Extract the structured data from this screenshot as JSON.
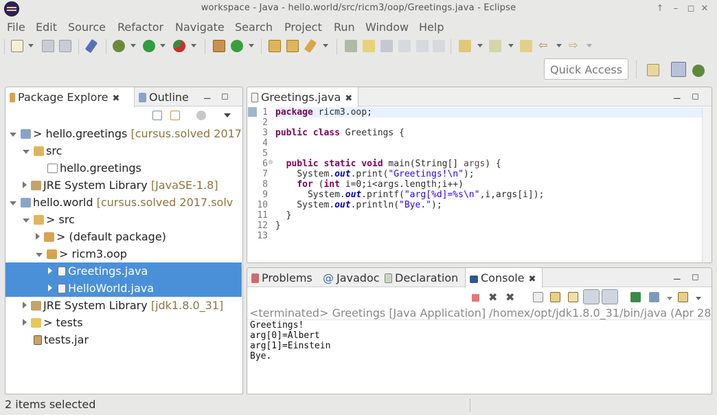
{
  "window": {
    "title": "workspace - Java - hello.world/src/ricm3/oop/Greetings.java - Eclipse"
  },
  "menu": [
    "File",
    "Edit",
    "Source",
    "Refactor",
    "Navigate",
    "Search",
    "Project",
    "Run",
    "Window",
    "Help"
  ],
  "quick_access": {
    "label": "Quick Access"
  },
  "left_pane": {
    "tabs": [
      {
        "label": "Package Explore"
      },
      {
        "label": "Outline"
      }
    ],
    "tree": [
      {
        "label": "> hello.greetings",
        "decor": "[cursus.solved 2017."
      },
      {
        "label": "src",
        "decor": ""
      },
      {
        "label": "hello.greetings",
        "decor": ""
      },
      {
        "label": "JRE System Library",
        "decor": "[JavaSE-1.8]"
      },
      {
        "label": "hello.world",
        "decor": "[cursus.solved 2017.solv"
      },
      {
        "label": "> src",
        "decor": ""
      },
      {
        "label": "> (default package)",
        "decor": ""
      },
      {
        "label": "> ricm3.oop",
        "decor": ""
      },
      {
        "label": "Greetings.java",
        "decor": ""
      },
      {
        "label": "HelloWorld.java",
        "decor": ""
      },
      {
        "label": "JRE System Library",
        "decor": "[jdk1.8.0_31]"
      },
      {
        "label": "> tests",
        "decor": ""
      },
      {
        "label": "tests.jar",
        "decor": ""
      }
    ]
  },
  "editor": {
    "tab": "Greetings.java",
    "lines": [
      "1",
      "2",
      "3",
      "4",
      "5",
      "6",
      "7",
      "8",
      "9",
      "10",
      "11",
      "12",
      "13"
    ]
  },
  "bottom_pane": {
    "tabs": [
      {
        "label": "Problems"
      },
      {
        "label": "Javadoc"
      },
      {
        "label": "Declaration"
      },
      {
        "label": "Console"
      }
    ],
    "console_header": "<terminated> Greetings [Java Application] /homex/opt/jdk1.8.0_31/bin/java (Apr 28,",
    "console_output": [
      "Greetings!",
      "arg[0]=Albert",
      "arg[1]=Einstein",
      "Bye."
    ]
  },
  "status": {
    "text": "2 items selected"
  },
  "colors": {
    "selection": "#4a90d9",
    "keyword": "#7f0055",
    "string": "#2a00ff",
    "field": "#0000c0"
  },
  "icons": [
    "eclipse-logo-icon",
    "new-icon",
    "save-icon",
    "save-all-icon",
    "debug-icon",
    "run-icon",
    "external-tools-icon",
    "package-icon",
    "java-file-icon",
    "folder-icon",
    "jar-icon",
    "console-icon",
    "terminate-icon",
    "remove-icon",
    "pin-icon",
    "minimize-icon",
    "maximize-icon",
    "perspective-icon",
    "java-perspective-icon",
    "debug-perspective-icon"
  ]
}
